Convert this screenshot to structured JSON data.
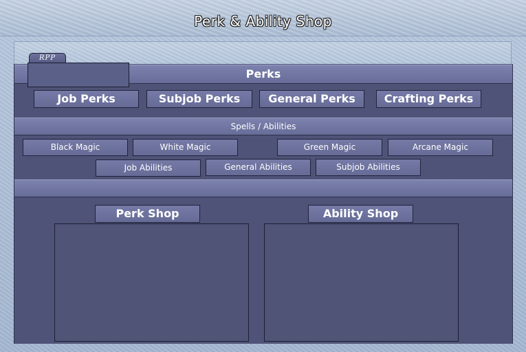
{
  "window": {
    "title": "Perk & Ability Shop"
  },
  "tabs": [
    {
      "label": "RPP"
    }
  ],
  "sections": {
    "perks": {
      "title": "Perks"
    },
    "spells": {
      "title": "Spells / Abilities"
    }
  },
  "perk_buttons": [
    "Job Perks",
    "Subjob Perks",
    "General Perks",
    "Crafting Perks"
  ],
  "magic_buttons": [
    "Black Magic",
    "White Magic",
    "Green Magic",
    "Arcane Magic"
  ],
  "ability_buttons": [
    "Job Abilities",
    "General Abilities",
    "Subjob Abilities"
  ],
  "shops": {
    "perk_shop_label": "Perk Shop",
    "ability_shop_label": "Ability Shop"
  },
  "colors": {
    "panel": "#4f5377",
    "button": "#6f749f",
    "frame": "#a9bdd6"
  }
}
